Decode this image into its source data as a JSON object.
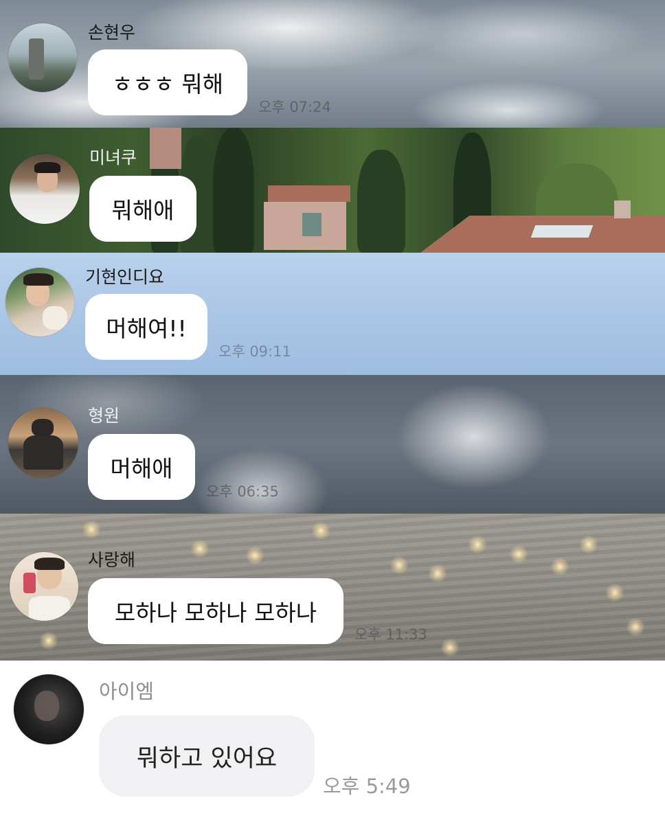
{
  "messages": [
    {
      "sender": "손현우",
      "text": "ㅎㅎㅎ 뭐해",
      "time": "오후 07:24"
    },
    {
      "sender": "미녀쿠",
      "text": "뭐해애",
      "time": ""
    },
    {
      "sender": "기현인디요",
      "text": "머해여!!",
      "time": "오후 09:11"
    },
    {
      "sender": "형원",
      "text": "머해애",
      "time": "오후 06:35"
    },
    {
      "sender": "사랑해",
      "text": "모하나 모하나 모하나",
      "time": "오후 11:33"
    },
    {
      "sender": "아이엠",
      "text": "뭐하고 있어요",
      "time": "오후 5:49"
    }
  ],
  "colors": {
    "bubble": "#ffffff",
    "bubble_plain": "#f1f1f3",
    "sky_blue": "#a8c4e4"
  }
}
